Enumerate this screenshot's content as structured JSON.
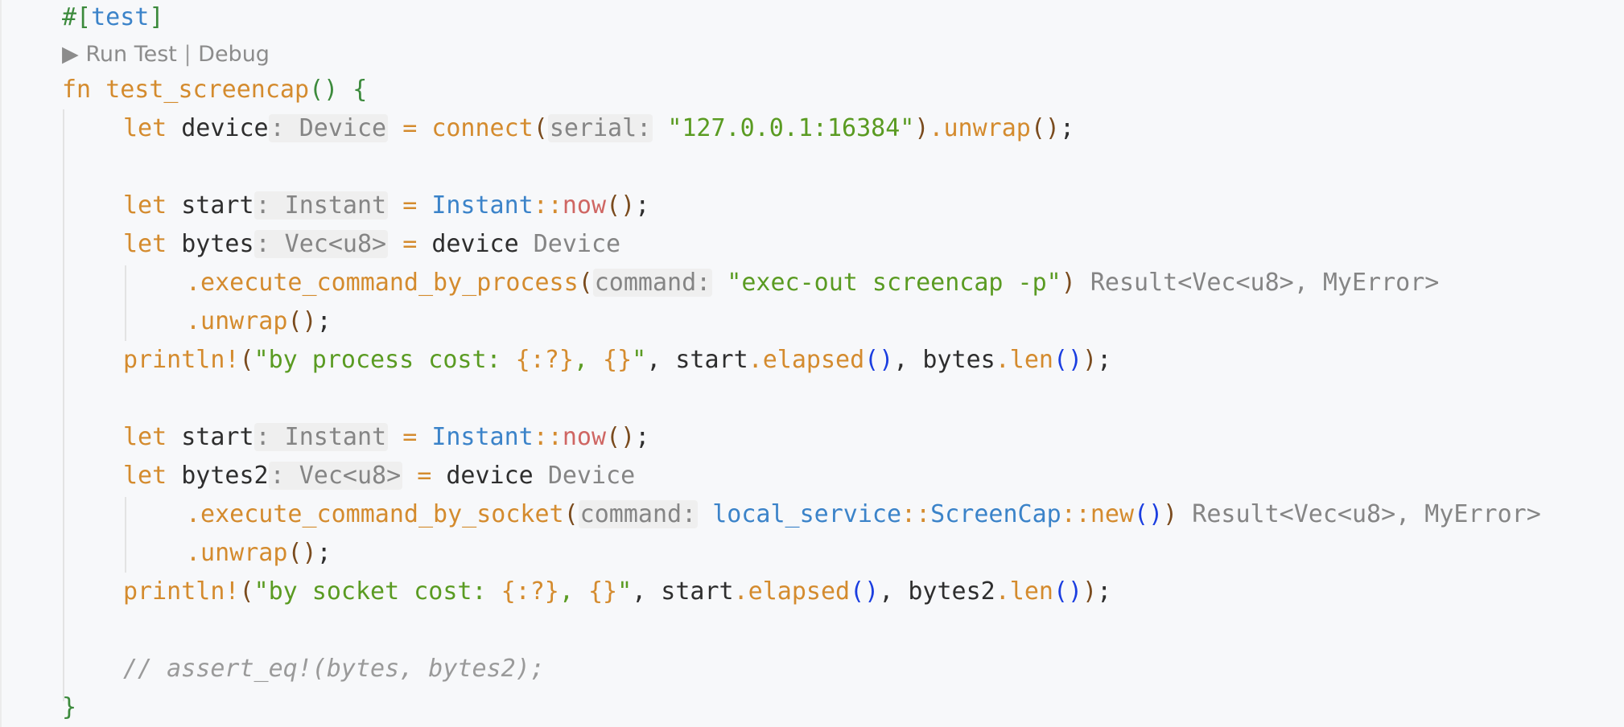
{
  "editor": {
    "attribute": {
      "hash": "#[",
      "name": "test",
      "close": "]"
    },
    "codelens": {
      "run_icon": "▶",
      "run_label": "Run Test",
      "separator": " | ",
      "debug_label": "Debug"
    },
    "fn_keyword": "fn",
    "fn_name": "test_screencap",
    "fn_parens": "()",
    "open_brace": "{",
    "close_brace": "}",
    "line_device": {
      "let": "let",
      "var": "device",
      "type_hint": ": Device",
      "eq": "=",
      "call": "connect",
      "open": "(",
      "param_hint": "serial:",
      "arg": "\"127.0.0.1:16384\"",
      "close": ")",
      "method": ".unwrap",
      "tail_parens": "()",
      "semi": ";"
    },
    "line_start1": {
      "let": "let",
      "var": "start",
      "type_hint": ": Instant",
      "eq": "=",
      "type": "Instant",
      "path_sep": "::",
      "fn": "now",
      "parens": "()",
      "semi": ";"
    },
    "line_bytes": {
      "let": "let",
      "var": "bytes",
      "type_hint": ": Vec<u8>",
      "eq": "=",
      "receiver": "device",
      "receiver_hint": "Device"
    },
    "line_exec_process": {
      "method": ".execute_command_by_process",
      "open": "(",
      "param_hint": "command:",
      "arg": "\"exec-out screencap -p\"",
      "close": ")",
      "result_hint": "Result<Vec<u8>, MyError>"
    },
    "line_unwrap1": {
      "method": ".unwrap",
      "parens": "()",
      "semi": ";"
    },
    "line_println1": {
      "macro": "println!",
      "open": "(",
      "str_start": "\"by process cost: ",
      "fmt1": "{:?}",
      "str_mid": ", ",
      "fmt2": "{}",
      "str_end": "\"",
      "comma1": ", ",
      "ident1": "start",
      "method1": ".elapsed",
      "parens1": "()",
      "comma2": ", ",
      "ident2": "bytes",
      "method2": ".len",
      "parens2": "()",
      "close": ")",
      "semi": ";"
    },
    "line_start2": {
      "let": "let",
      "var": "start",
      "type_hint": ": Instant",
      "eq": "=",
      "type": "Instant",
      "path_sep": "::",
      "fn": "now",
      "parens": "()",
      "semi": ";"
    },
    "line_bytes2": {
      "let": "let",
      "var": "bytes2",
      "type_hint": ": Vec<u8>",
      "eq": "=",
      "receiver": "device",
      "receiver_hint": "Device"
    },
    "line_exec_socket": {
      "method": ".execute_command_by_socket",
      "open": "(",
      "param_hint": "command:",
      "module": "local_service",
      "path_sep1": "::",
      "type": "ScreenCap",
      "path_sep2": "::",
      "fn": "new",
      "inner_parens": "()",
      "close": ")",
      "result_hint": "Result<Vec<u8>, MyError>"
    },
    "line_unwrap2": {
      "method": ".unwrap",
      "parens": "()",
      "semi": ";"
    },
    "line_println2": {
      "macro": "println!",
      "open": "(",
      "str_start": "\"by socket cost: ",
      "fmt1": "{:?}",
      "str_mid": ", ",
      "fmt2": "{}",
      "str_end": "\"",
      "comma1": ", ",
      "ident1": "start",
      "method1": ".elapsed",
      "parens1": "()",
      "comma2": ", ",
      "ident2": "bytes2",
      "method2": ".len",
      "parens2": "()",
      "close": ")",
      "semi": ";"
    },
    "line_comment": {
      "text": "// assert_eq!(bytes, bytes2);"
    }
  },
  "colors": {
    "background": "#f7f8fa",
    "keyword": "#d48b2e",
    "string": "#5a9b22",
    "type": "#3b83c9",
    "hint": "#858585",
    "comment": "#9a9a9a"
  }
}
